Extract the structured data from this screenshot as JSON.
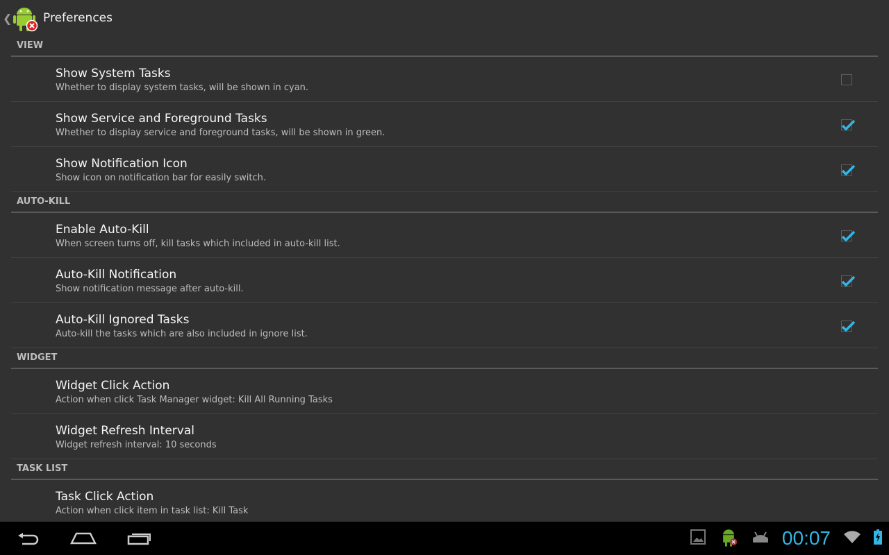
{
  "actionbar": {
    "title": "Preferences",
    "icon": "task-manager-android-icon"
  },
  "sections": [
    {
      "header": "VIEW",
      "items": [
        {
          "title": "Show System Tasks",
          "summary": "Whether to display system tasks, will be shown in cyan.",
          "checked": false
        },
        {
          "title": "Show Service and Foreground Tasks",
          "summary": "Whether to display service and foreground tasks, will be shown in green.",
          "checked": true
        },
        {
          "title": "Show Notification Icon",
          "summary": "Show icon on notification bar for easily switch.",
          "checked": true
        }
      ]
    },
    {
      "header": "AUTO-KILL",
      "items": [
        {
          "title": "Enable Auto-Kill",
          "summary": "When screen turns off, kill tasks which included in auto-kill list.",
          "checked": true
        },
        {
          "title": "Auto-Kill Notification",
          "summary": "Show notification message after auto-kill.",
          "checked": true
        },
        {
          "title": "Auto-Kill Ignored Tasks",
          "summary": "Auto-kill the tasks which are also included in ignore list.",
          "checked": true
        }
      ]
    },
    {
      "header": "WIDGET",
      "items": [
        {
          "title": "Widget Click Action",
          "summary": "Action when click Task Manager widget: Kill All Running Tasks"
        },
        {
          "title": "Widget Refresh Interval",
          "summary": "Widget refresh interval: 10 seconds"
        }
      ]
    },
    {
      "header": "TASK LIST",
      "items": [
        {
          "title": "Task Click Action",
          "summary": "Action when click item in task list: Kill Task"
        }
      ]
    }
  ],
  "statusbar": {
    "clock": "00:07",
    "accent": "#33b5e5"
  },
  "colors": {
    "background": "#313131",
    "checkmark": "#33b5e5"
  }
}
